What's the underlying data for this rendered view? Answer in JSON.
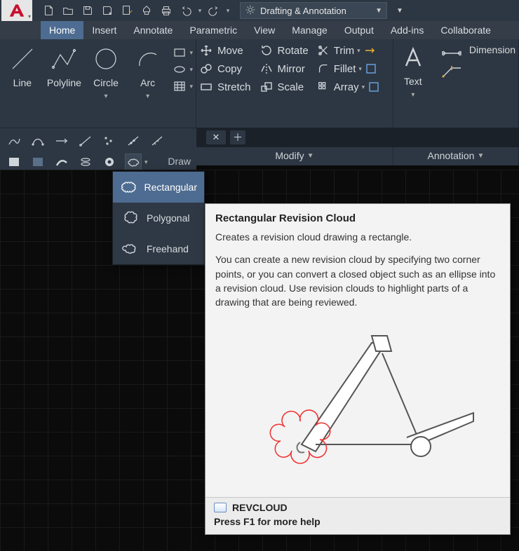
{
  "workspace": {
    "label": "Drafting & Annotation"
  },
  "tabs": [
    "Home",
    "Insert",
    "Annotate",
    "Parametric",
    "View",
    "Manage",
    "Output",
    "Add-ins",
    "Collaborate"
  ],
  "tabs_active_index": 0,
  "ribbon": {
    "draw": {
      "title": "Draw",
      "tools": {
        "line": "Line",
        "polyline": "Polyline",
        "circle": "Circle",
        "arc": "Arc"
      }
    },
    "modify": {
      "title": "Modify",
      "items": {
        "move": "Move",
        "rotate": "Rotate",
        "trim": "Trim",
        "copy": "Copy",
        "mirror": "Mirror",
        "fillet": "Fillet",
        "stretch": "Stretch",
        "scale": "Scale",
        "array": "Array"
      }
    },
    "annotation": {
      "title": "Annotation",
      "text_label": "Text",
      "dimension_label": "Dimension"
    }
  },
  "revcloud_menu": {
    "rectangular": "Rectangular",
    "polygonal": "Polygonal",
    "freehand": "Freehand"
  },
  "tooltip": {
    "title": "Rectangular Revision Cloud",
    "summary": "Creates a revision cloud drawing a rectangle.",
    "detail": "You can create a new revision cloud by specifying two corner points, or you can convert a closed object such as an ellipse into a revision cloud. Use revision clouds to highlight parts of a drawing that are being reviewed.",
    "command": "REVCLOUD",
    "help_hint": "Press F1 for more help"
  }
}
